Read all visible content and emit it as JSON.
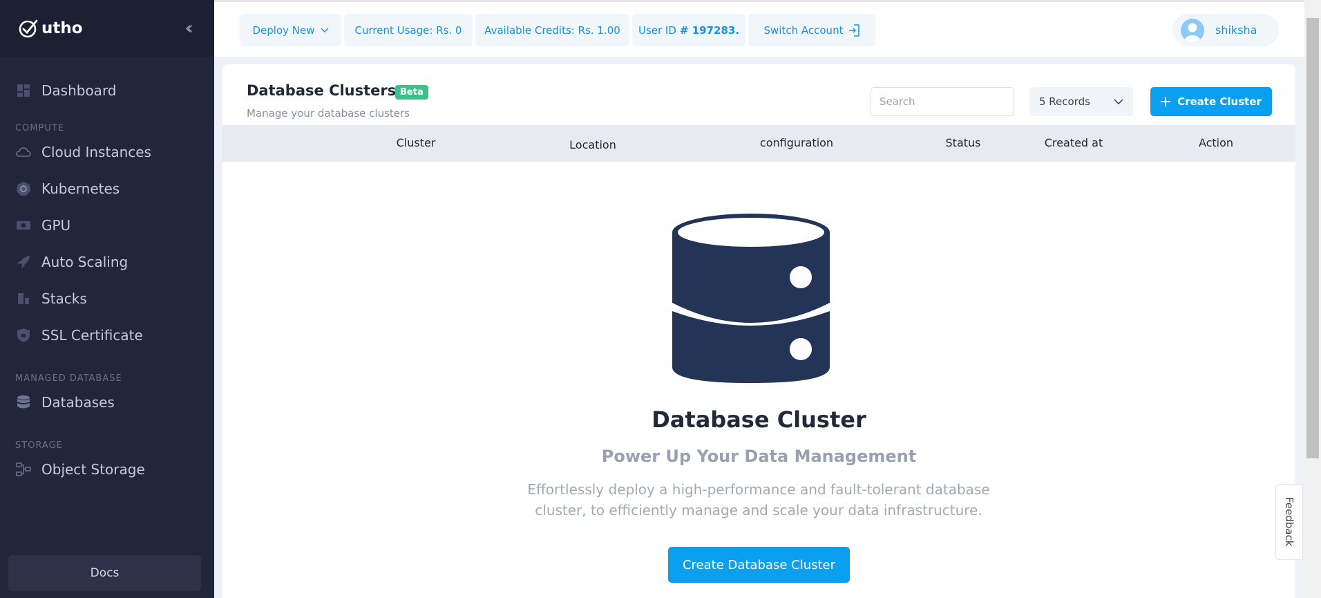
{
  "sidebar": {
    "brand": "utho",
    "items": [
      {
        "label": "Dashboard"
      },
      {
        "section": "COMPUTE"
      },
      {
        "label": "Cloud Instances"
      },
      {
        "label": "Kubernetes"
      },
      {
        "label": "GPU"
      },
      {
        "label": "Auto Scaling"
      },
      {
        "label": "Stacks"
      },
      {
        "label": "SSL Certificate"
      },
      {
        "section": "MANAGED DATABASE"
      },
      {
        "label": "Databases"
      },
      {
        "section": "STORAGE"
      },
      {
        "label": "Object Storage"
      }
    ],
    "docs": "Docs"
  },
  "topbar": {
    "deploy_new": "Deploy New",
    "current_usage": "Current Usage: Rs. 0",
    "available_credits": "Available Credits: Rs. 1.00",
    "user_id_label": "User ID",
    "user_id_value": "# 197283.",
    "switch_account": "Switch Account",
    "username": "shiksha"
  },
  "page": {
    "title": "Database Clusters",
    "badge": "Beta",
    "subtitle": "Manage your database clusters",
    "search_placeholder": "Search",
    "records_value": "5 Records",
    "create_button": "Create Cluster",
    "columns": [
      "Cluster",
      "Location",
      "configuration",
      "Status",
      "Created at",
      "Action"
    ]
  },
  "empty": {
    "title": "Database Cluster",
    "subtitle": "Power Up Your Data Management",
    "description": "Effortlessly deploy a high-performance and fault-tolerant database cluster, to efficiently manage and scale your data infrastructure.",
    "button": "Create Database Cluster"
  },
  "feedback": "Feedback",
  "colors": {
    "sidebar": "#22263a",
    "accent": "#0aa0ef",
    "beta": "#39c28a",
    "illustration": "#233457"
  }
}
